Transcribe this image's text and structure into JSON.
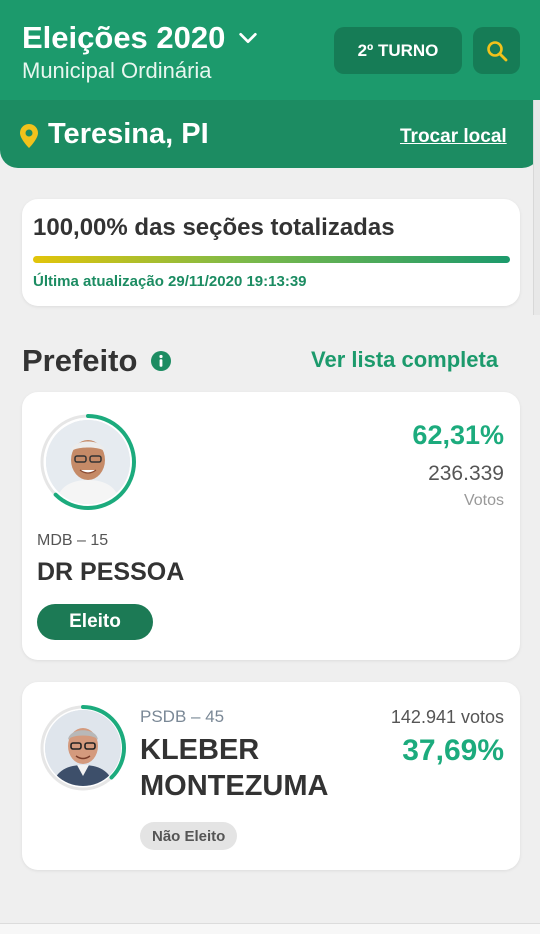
{
  "header": {
    "title": "Eleições 2020",
    "subtitle": "Municipal Ordinária",
    "turno_label": "2º TURNO",
    "location": "Teresina, PI",
    "change_location": "Trocar local"
  },
  "progress": {
    "title": "100,00% das seções totalizadas",
    "percent": 100,
    "updated": "Última atualização 29/11/2020 19:13:39"
  },
  "section": {
    "title": "Prefeito",
    "view_all": "Ver lista completa"
  },
  "candidates": [
    {
      "party": "MDB – 15",
      "name": "DR PESSOA",
      "percent": "62,31%",
      "percent_value": 62.31,
      "votes": "236.339",
      "votes_label": "Votos",
      "status": "Eleito"
    },
    {
      "party": "PSDB – 45",
      "name_line1": "KLEBER",
      "name_line2": "MONTEZUMA",
      "percent": "37,69%",
      "percent_value": 37.69,
      "votes": "142.941 votos",
      "status": "Não Eleito"
    }
  ],
  "colors": {
    "brand_green": "#1c9a6c",
    "dark_green": "#1c8c62",
    "percent_green": "#1cab7d",
    "pin_yellow": "#f2c21b"
  },
  "icons": {
    "title_dropdown": "chevron-down-icon",
    "search": "search-icon",
    "location": "location-pin-icon",
    "info": "info-icon"
  }
}
